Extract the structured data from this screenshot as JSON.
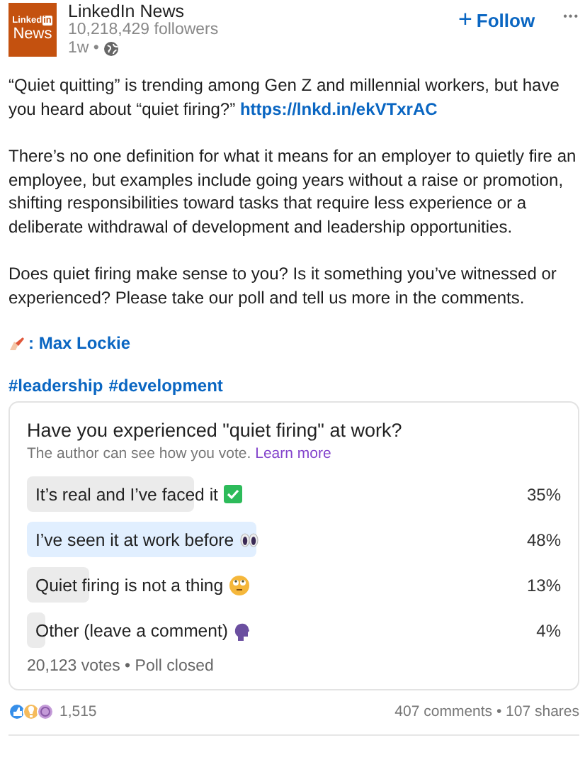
{
  "author": {
    "logo_top": "Linked",
    "logo_in": "in",
    "logo_bottom": "News",
    "name": "LinkedIn News",
    "followers": "10,218,429 followers",
    "time": "1w •"
  },
  "follow_button": {
    "icon": "+",
    "label": "Follow"
  },
  "more_button": "•••",
  "paragraphs": [
    {
      "text": "“Quiet quitting” is trending among Gen Z and millennial workers, but have you heard about “quiet firing?” ",
      "link": "https://lnkd.in/ekVTxrAC"
    },
    {
      "text": "There’s no one definition for what it means for an employer to quietly fire an employee, but examples include going years without a raise or promotion, shifting responsibilities toward tasks that require less experience or a deliberate withdrawal of development and leadership opportunities."
    },
    {
      "text": "Does quiet firing make sense to you? Is it something you’ve witnessed or experienced? Please take our poll and tell us more in the comments."
    }
  ],
  "credit": ": Max Lockie",
  "hashtags": [
    "#leadership",
    "#development"
  ],
  "poll": {
    "question": "Have you experienced \"quiet firing\" at work?",
    "note": "The author can see how you vote.",
    "note_link": "Learn more",
    "options": [
      {
        "label": "It’s real and I’ve faced it",
        "percent": "35%",
        "selected": false
      },
      {
        "label": "I’ve seen it at work before",
        "percent": "48%",
        "selected": true
      },
      {
        "label": "Quiet firing is not a thing",
        "percent": "13%",
        "selected": false
      },
      {
        "label": "Other (leave a comment)",
        "percent": "4%",
        "selected": false
      }
    ],
    "footer": "20,123 votes • Poll closed"
  },
  "social": {
    "reactions": "1,515",
    "comments_shares": "407 comments • 107 shares"
  }
}
